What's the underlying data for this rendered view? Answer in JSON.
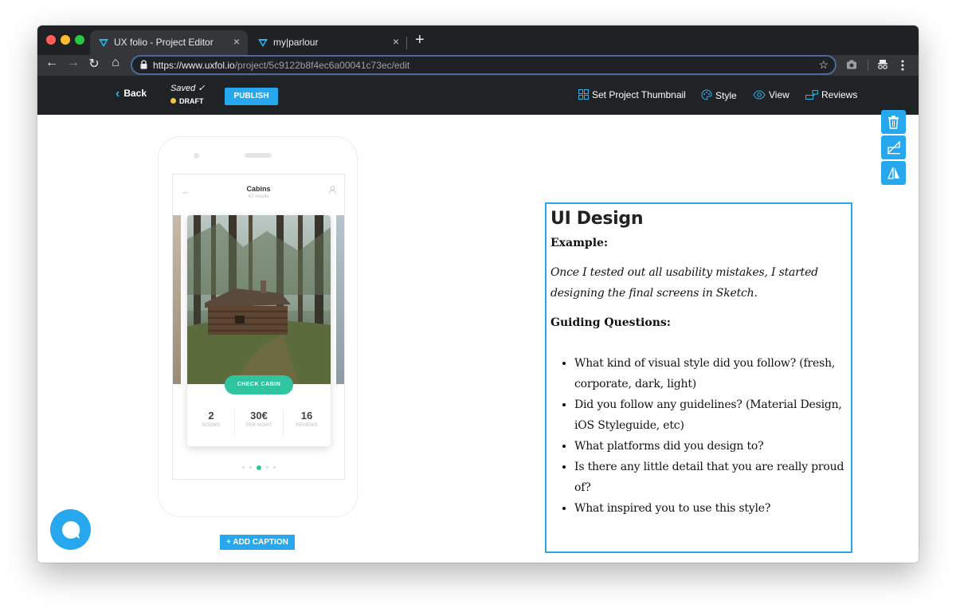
{
  "browser": {
    "tabs": [
      {
        "title": "UX folio - Project Editor",
        "close": "×",
        "active": true
      },
      {
        "title": "my|parlour",
        "close": "×",
        "active": false
      }
    ],
    "new_tab": "+",
    "nav": {
      "back": "←",
      "forward": "→",
      "reload": "↻",
      "home": "⌂"
    },
    "url": {
      "origin": "https://www.uxfol.io",
      "path": "/project/5c9122b8f4ec6a00041c73ec/edit"
    },
    "bookmark_star": "☆",
    "colors": {
      "accent": "#27a7ee",
      "tab_bar": "#202124",
      "toolbar": "#35363a"
    }
  },
  "editor": {
    "back_label": "Back",
    "saved_label": "Saved ✓",
    "draft_label": "DRAFT",
    "publish_label": "PUBLISH",
    "actions": [
      {
        "label": "Set Project Thumbnail",
        "icon": "grid-icon"
      },
      {
        "label": "Style",
        "icon": "palette-icon"
      },
      {
        "label": "View",
        "icon": "eye-icon"
      },
      {
        "label": "Reviews",
        "icon": "reviews-icon"
      }
    ],
    "colors": {
      "app_bar": "#1f2326",
      "publish": "#27a7ee",
      "draft_dot": "#f4c542"
    }
  },
  "phone_mock": {
    "screen_title": "Cabins",
    "screen_subtitle": "42 results",
    "cta_label": "CHECK CABIN",
    "stats": [
      {
        "value": "2",
        "label": "ROOMS"
      },
      {
        "value": "30€",
        "label": "PER NIGHT"
      },
      {
        "value": "16",
        "label": "REVIEWS"
      }
    ],
    "pagination": {
      "count": 5,
      "active": 3
    },
    "accent": "#2ec5a0"
  },
  "caption_button": "+ ADD CAPTION",
  "text_block": {
    "heading": "UI Design",
    "example_label": "Example:",
    "example_text": "Once I tested out all usability mistakes, I started designing the final screens in Sketch.",
    "questions_label": "Guiding Questions:",
    "questions": [
      "What kind of visual style did you follow? (fresh, corporate, dark, light)",
      "Did you follow any guidelines? (Material Design, iOS Styleguide, etc)",
      "What platforms did you design to?",
      "Is there any little detail that you are really proud of?",
      "What inspired you to use this style?"
    ]
  },
  "side_tools": [
    "trash-icon",
    "flip-vertical-icon",
    "flip-horizontal-icon"
  ]
}
